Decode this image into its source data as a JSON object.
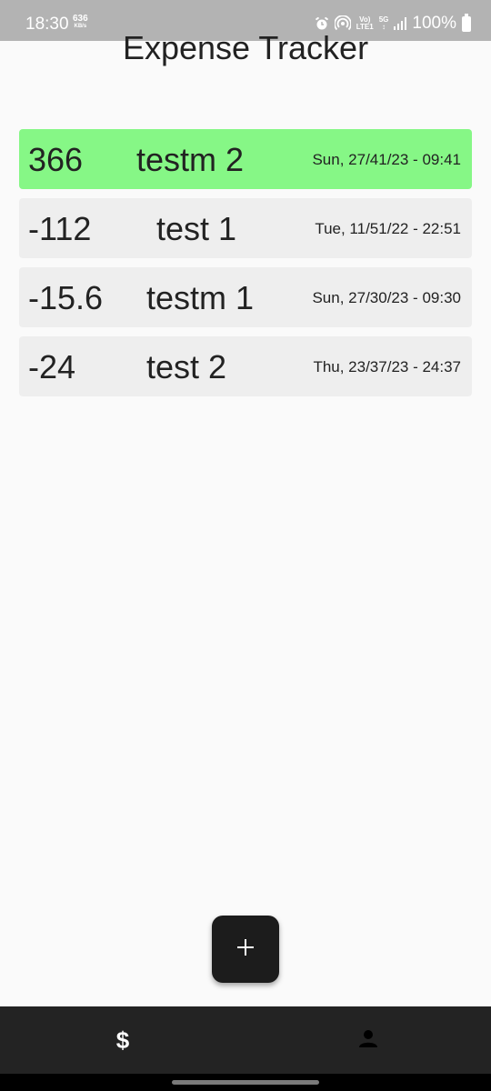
{
  "status_bar": {
    "time": "18:30",
    "net_speed": "636",
    "net_unit": "KB/s",
    "volte": "Vo)",
    "lte": "LTE1",
    "signal_5g": "5G",
    "battery": "100%"
  },
  "app": {
    "title": "Expense Tracker"
  },
  "transactions": [
    {
      "amount": "366",
      "name": "testm 2",
      "date": "Sun, 27/41/23 - 09:41",
      "highlighted": true,
      "highlight_color": "#86f786"
    },
    {
      "amount": "-112",
      "name": "test 1",
      "date": "Tue, 11/51/22 - 22:51",
      "highlighted": false
    },
    {
      "amount": "-15.6",
      "name": "testm 1",
      "date": "Sun, 27/30/23 - 09:30",
      "highlighted": false
    },
    {
      "amount": "-24",
      "name": "test 2",
      "date": "Thu, 23/37/23 - 24:37",
      "highlighted": false
    }
  ],
  "fab": {
    "icon": "plus-icon"
  },
  "bottom_nav": {
    "items": [
      {
        "icon": "dollar-icon",
        "glyph": "$"
      },
      {
        "icon": "person-icon"
      }
    ]
  },
  "colors": {
    "accent_row": "#86f786",
    "row_bg": "#eeeeee",
    "nav_bg": "#232323",
    "fab_bg": "#1c1c1c"
  }
}
